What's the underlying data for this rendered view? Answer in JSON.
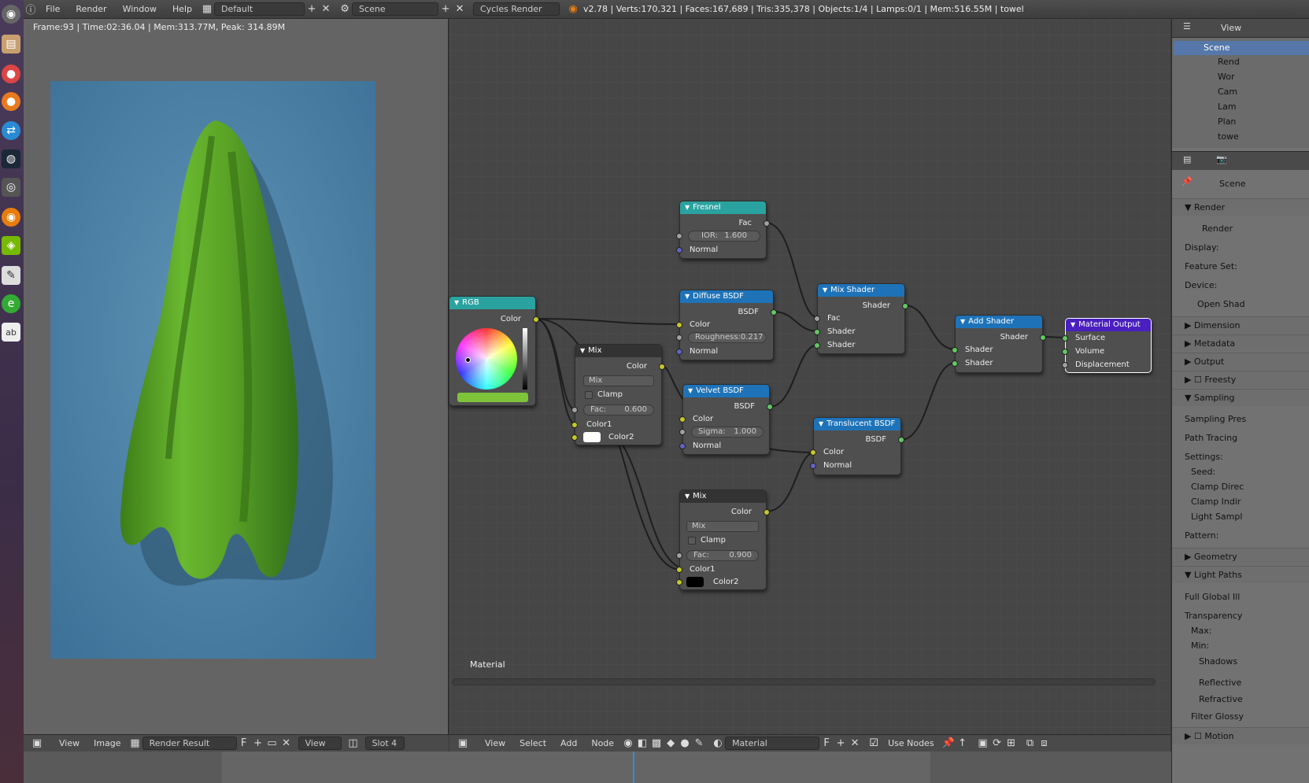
{
  "topbar": {
    "menus": [
      "File",
      "Render",
      "Window",
      "Help"
    ],
    "layout": "Default",
    "scene": "Scene",
    "engine": "Cycles Render",
    "stats": "v2.78 | Verts:170,321 | Faces:167,689 | Tris:335,378 | Objects:1/4 | Lamps:0/1 | Mem:516.55M | towel"
  },
  "image_editor": {
    "render_info": "Frame:93 | Time:02:36.04 | Mem:313.77M, Peak: 314.89M",
    "bottom": {
      "view": "View",
      "image": "Image",
      "image_name": "Render Result",
      "f_label": "F",
      "view_field": "View",
      "slot": "Slot 4"
    }
  },
  "node_editor": {
    "material_label": "Material",
    "bottom": {
      "view": "View",
      "select": "Select",
      "add": "Add",
      "node": "Node",
      "material_field": "Material",
      "f_label": "F",
      "use_nodes": "Use Nodes"
    },
    "nodes": {
      "fresnel": {
        "title": "Fresnel",
        "out_fac": "Fac",
        "ior_label": "IOR:",
        "ior_value": "1.600",
        "normal": "Normal"
      },
      "diffuse": {
        "title": "Diffuse BSDF",
        "out": "BSDF",
        "color": "Color",
        "roughness": "Roughness:0.217",
        "normal": "Normal"
      },
      "mixshader": {
        "title": "Mix Shader",
        "out": "Shader",
        "fac": "Fac",
        "shader1": "Shader",
        "shader2": "Shader"
      },
      "addshader": {
        "title": "Add Shader",
        "out": "Shader",
        "shader1": "Shader",
        "shader2": "Shader"
      },
      "output": {
        "title": "Material Output",
        "surface": "Surface",
        "volume": "Volume",
        "displacement": "Displacement"
      },
      "rgb": {
        "title": "RGB",
        "out": "Color",
        "swatch": "#7dc43a"
      },
      "mix1": {
        "title": "Mix",
        "out": "Color",
        "mode": "Mix",
        "clamp": "Clamp",
        "fac_label": "Fac:",
        "fac_value": "0.600",
        "color1": "Color1",
        "color2": "Color2",
        "color2_swatch": "#ffffff"
      },
      "velvet": {
        "title": "Velvet BSDF",
        "out": "BSDF",
        "color": "Color",
        "sigma_label": "Sigma:",
        "sigma_value": "1.000",
        "normal": "Normal"
      },
      "translucent": {
        "title": "Translucent BSDF",
        "out": "BSDF",
        "color": "Color",
        "normal": "Normal"
      },
      "mix2": {
        "title": "Mix",
        "out": "Color",
        "mode": "Mix",
        "clamp": "Clamp",
        "fac_label": "Fac:",
        "fac_value": "0.900",
        "color1": "Color1",
        "color2": "Color2",
        "color2_swatch": "#000000"
      }
    }
  },
  "outliner": {
    "view": "View",
    "items": [
      "Scene",
      "Rend",
      "Wor",
      "Cam",
      "Lam",
      "Plan",
      "towe"
    ]
  },
  "properties": {
    "scene": "Scene",
    "sections": {
      "render": "Render",
      "render_btn": "Render",
      "display": "Display:",
      "feature_set": "Feature Set:",
      "device": "Device:",
      "open_shading": "Open Shad",
      "dimensions": "Dimension",
      "metadata": "Metadata",
      "output": "Output",
      "freestyle": "Freesty",
      "sampling": "Sampling",
      "sampling_presets": "Sampling Pres",
      "path_tracing": "Path Tracing",
      "settings": "Settings:",
      "seed": "Seed:",
      "clamp_direct": "Clamp Direc",
      "clamp_indirect": "Clamp Indir",
      "light_sampling": "Light Sampl",
      "pattern": "Pattern:",
      "geometry": "Geometry",
      "light_paths": "Light Paths",
      "full_global": "Full Global Ill",
      "transparency": "Transparency",
      "max": "Max:",
      "min": "Min:",
      "shadows": "Shadows",
      "reflective": "Reflective",
      "refractive": "Refractive",
      "filter_glossy": "Filter Glossy",
      "motion": "Motion"
    }
  },
  "colors": {
    "fresnel_head": "#2aa3a0",
    "bsdf_head": "#1e73b8",
    "rgb_head": "#2aa3a0",
    "mix_head": "#333333",
    "output_head": "#4a1fbf",
    "towel": "#5fae28"
  }
}
